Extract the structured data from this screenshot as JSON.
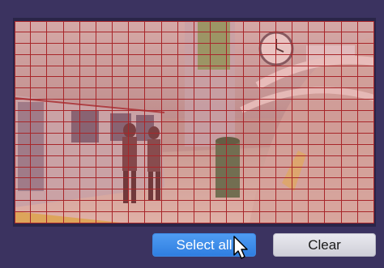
{
  "camera_view": {
    "grid_columns": 22,
    "grid_rows": 18,
    "grid_line_color": "#a8262a",
    "selection_overlay_color": "#cd5050"
  },
  "buttons": {
    "select_all_label": "Select all",
    "clear_label": "Clear"
  },
  "colors": {
    "background": "#3b3360",
    "select_all_button": "#3b8ae8",
    "clear_button": "#dcdce4"
  },
  "cursor_icon": "arrow-pointer-icon"
}
